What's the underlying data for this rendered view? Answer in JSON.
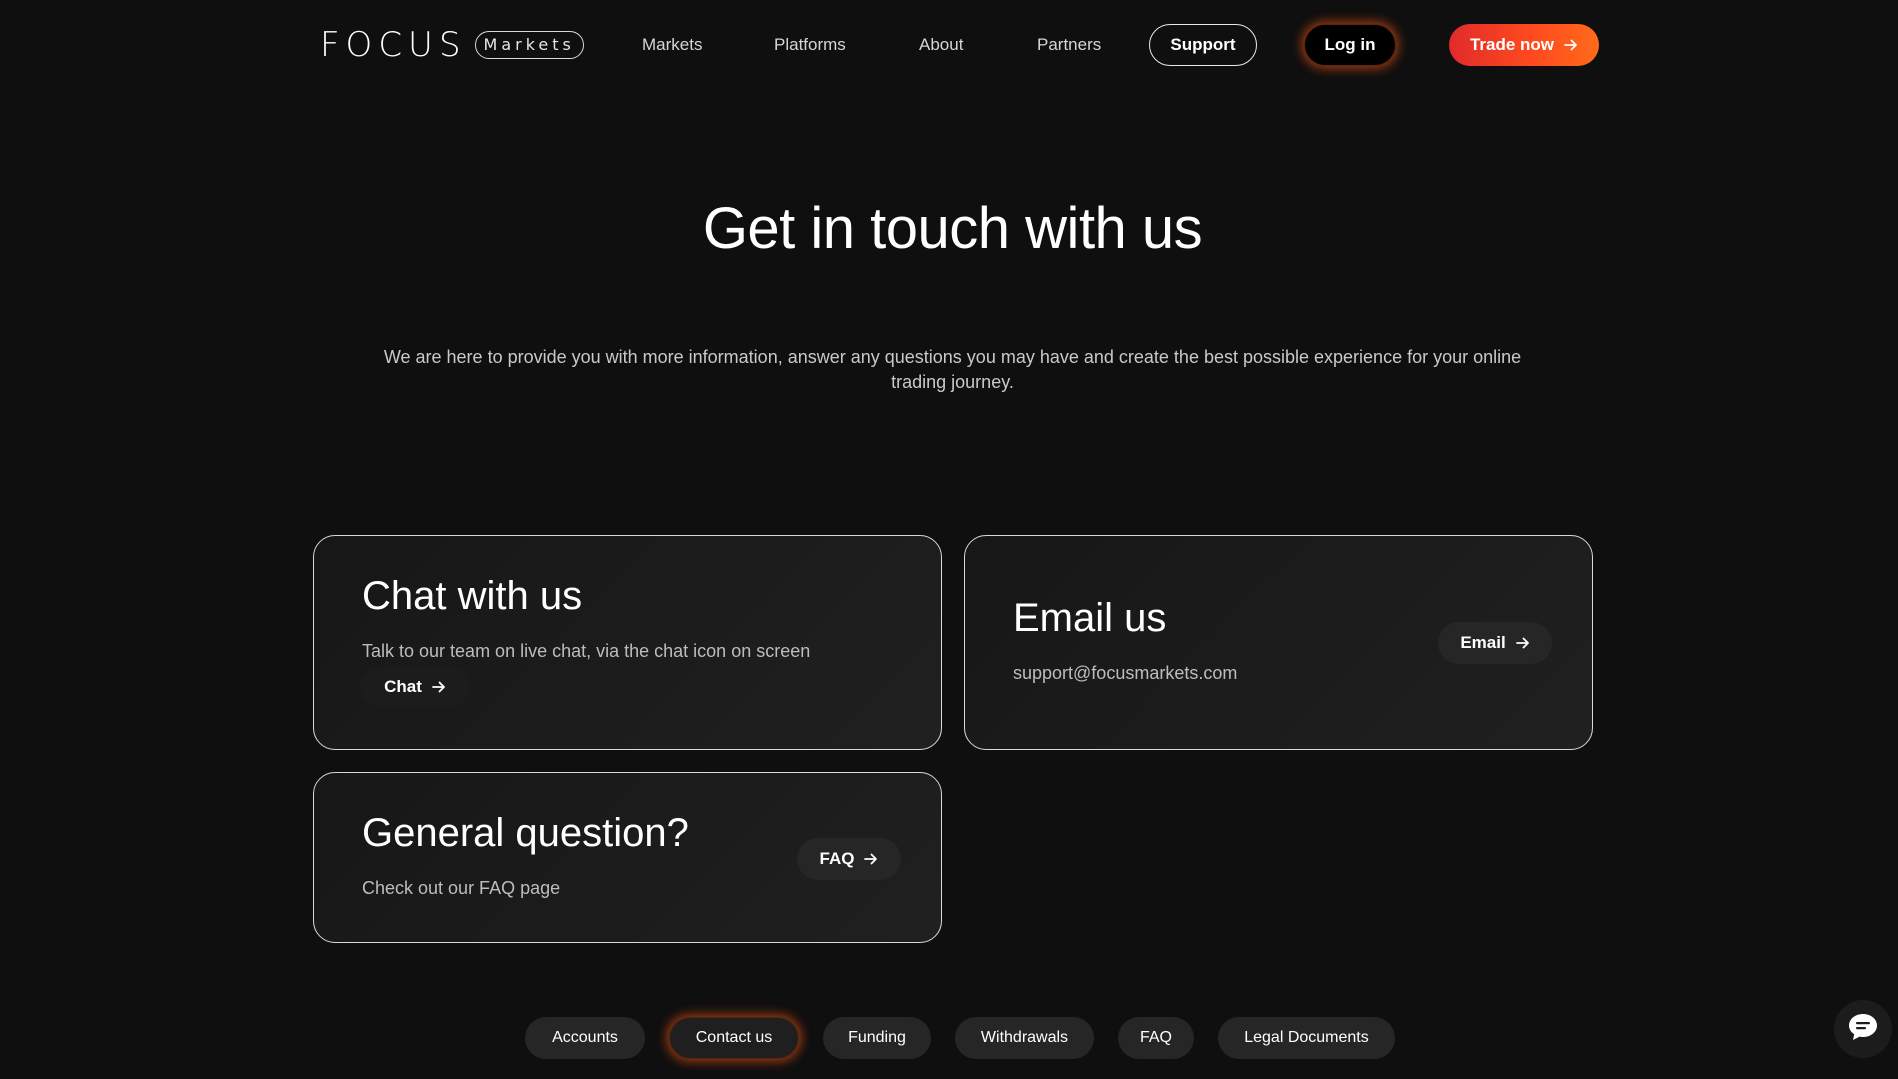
{
  "header": {
    "logo_word": "FOCUS",
    "logo_pill": "Markets",
    "nav": [
      {
        "label": "Markets"
      },
      {
        "label": "Platforms"
      },
      {
        "label": "About"
      },
      {
        "label": "Partners"
      }
    ],
    "support_label": "Support",
    "login_label": "Log in",
    "trade_label": "Trade now"
  },
  "hero": {
    "title": "Get in touch with us",
    "subtitle": "We are here to provide you with more information, answer any questions you may have and create the best possible experience for your online trading journey."
  },
  "cards": {
    "chat": {
      "title": "Chat with us",
      "text": "Talk to our team on live chat, via the chat icon on screen",
      "button": "Chat"
    },
    "email": {
      "title": "Email us",
      "text": "support@focusmarkets.com",
      "button": "Email"
    },
    "faq": {
      "title": "General question?",
      "text": "Check out our FAQ page",
      "button": "FAQ"
    }
  },
  "tabs": [
    {
      "label": "Accounts",
      "active": false
    },
    {
      "label": "Contact us",
      "active": true
    },
    {
      "label": "Funding",
      "active": false
    },
    {
      "label": "Withdrawals",
      "active": false
    },
    {
      "label": "FAQ",
      "active": false
    },
    {
      "label": "Legal Documents",
      "active": false
    }
  ],
  "icons": {
    "arrow": "arrow-right-icon",
    "chat_fab": "chat-bubble-icon"
  },
  "colors": {
    "background": "#0f0f0f",
    "accent_red": "#e02b2b",
    "accent_orange": "#ff6a1a",
    "card_bg": "#1b1b1b",
    "pill_bg": "#262626"
  }
}
